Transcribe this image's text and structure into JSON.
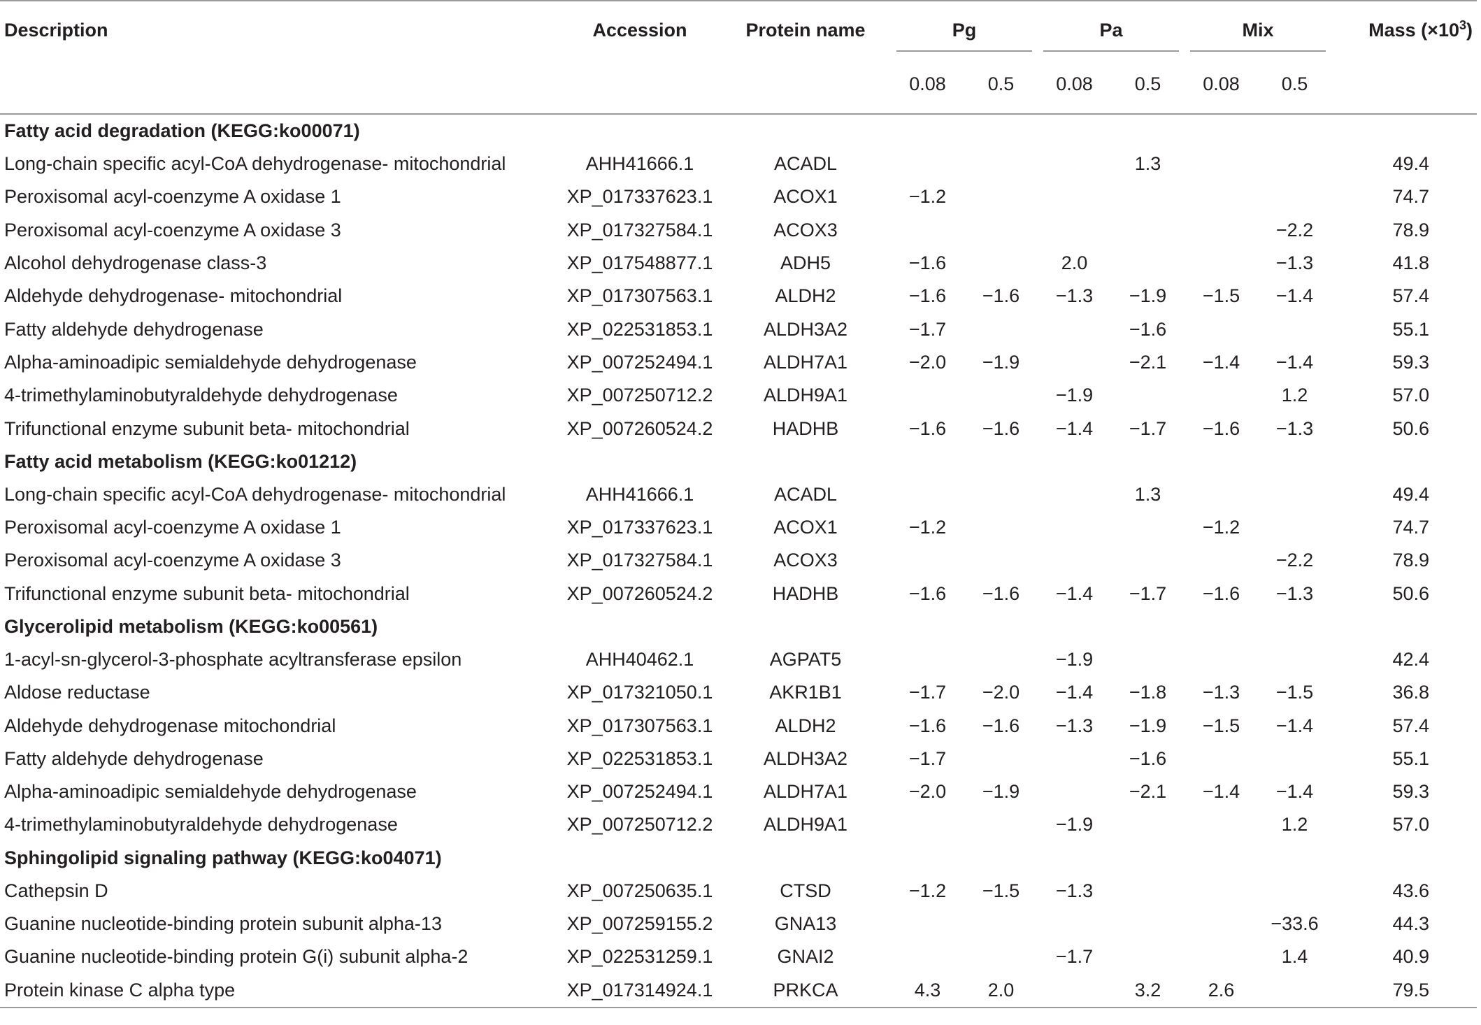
{
  "headers": {
    "description": "Description",
    "accession": "Accession",
    "protein_name": "Protein name",
    "pg": "Pg",
    "pa": "Pa",
    "mix": "Mix",
    "mass": "Mass (×10",
    "mass_exp": "3",
    "mass_close": ")",
    "sub": [
      "0.08",
      "0.5",
      "0.08",
      "0.5",
      "0.08",
      "0.5"
    ]
  },
  "sections": [
    {
      "title": "Fatty acid degradation (KEGG:ko00071)",
      "rows": [
        {
          "description": "Long-chain specific acyl-CoA dehydrogenase- mitochondrial",
          "accession": "AHH41666.1",
          "protein": "ACADL",
          "values": [
            "",
            "",
            "",
            "1.3",
            "",
            ""
          ],
          "mass": "49.4"
        },
        {
          "description": "Peroxisomal acyl-coenzyme A oxidase 1",
          "accession": "XP_017337623.1",
          "protein": "ACOX1",
          "values": [
            "−1.2",
            "",
            "",
            "",
            "",
            ""
          ],
          "mass": "74.7"
        },
        {
          "description": "Peroxisomal acyl-coenzyme A oxidase 3",
          "accession": "XP_017327584.1",
          "protein": "ACOX3",
          "values": [
            "",
            "",
            "",
            "",
            "",
            "−2.2"
          ],
          "mass": "78.9"
        },
        {
          "description": "Alcohol dehydrogenase class-3",
          "accession": "XP_017548877.1",
          "protein": "ADH5",
          "values": [
            "−1.6",
            "",
            "2.0",
            "",
            "",
            "−1.3"
          ],
          "mass": "41.8"
        },
        {
          "description": "Aldehyde dehydrogenase- mitochondrial",
          "accession": "XP_017307563.1",
          "protein": "ALDH2",
          "values": [
            "−1.6",
            "−1.6",
            "−1.3",
            "−1.9",
            "−1.5",
            "−1.4"
          ],
          "mass": "57.4"
        },
        {
          "description": "Fatty aldehyde dehydrogenase",
          "accession": "XP_022531853.1",
          "protein": "ALDH3A2",
          "values": [
            "−1.7",
            "",
            "",
            "−1.6",
            "",
            ""
          ],
          "mass": "55.1"
        },
        {
          "description": "Alpha-aminoadipic semialdehyde dehydrogenase",
          "accession": "XP_007252494.1",
          "protein": "ALDH7A1",
          "values": [
            "−2.0",
            "−1.9",
            "",
            "−2.1",
            "−1.4",
            "−1.4"
          ],
          "mass": "59.3"
        },
        {
          "description": "4-trimethylaminobutyraldehyde dehydrogenase",
          "accession": "XP_007250712.2",
          "protein": "ALDH9A1",
          "values": [
            "",
            "",
            "−1.9",
            "",
            "",
            "1.2"
          ],
          "mass": "57.0"
        },
        {
          "description": "Trifunctional enzyme subunit beta- mitochondrial",
          "accession": "XP_007260524.2",
          "protein": "HADHB",
          "values": [
            "−1.6",
            "−1.6",
            "−1.4",
            "−1.7",
            "−1.6",
            "−1.3"
          ],
          "mass": "50.6"
        }
      ]
    },
    {
      "title": "Fatty acid metabolism (KEGG:ko01212)",
      "rows": [
        {
          "description": "Long-chain specific acyl-CoA dehydrogenase- mitochondrial",
          "accession": "AHH41666.1",
          "protein": "ACADL",
          "values": [
            "",
            "",
            "",
            "1.3",
            "",
            ""
          ],
          "mass": "49.4"
        },
        {
          "description": "Peroxisomal acyl-coenzyme A oxidase 1",
          "accession": "XP_017337623.1",
          "protein": "ACOX1",
          "values": [
            "−1.2",
            "",
            "",
            "",
            "−1.2",
            ""
          ],
          "mass": "74.7"
        },
        {
          "description": "Peroxisomal acyl-coenzyme A oxidase 3",
          "accession": "XP_017327584.1",
          "protein": "ACOX3",
          "values": [
            "",
            "",
            "",
            "",
            "",
            "−2.2"
          ],
          "mass": "78.9"
        },
        {
          "description": "Trifunctional enzyme subunit beta- mitochondrial",
          "accession": "XP_007260524.2",
          "protein": "HADHB",
          "values": [
            "−1.6",
            "−1.6",
            "−1.4",
            "−1.7",
            "−1.6",
            "−1.3"
          ],
          "mass": "50.6"
        }
      ]
    },
    {
      "title": "Glycerolipid metabolism (KEGG:ko00561)",
      "rows": [
        {
          "description": "1-acyl-sn-glycerol-3-phosphate acyltransferase epsilon",
          "accession": "AHH40462.1",
          "protein": "AGPAT5",
          "values": [
            "",
            "",
            "−1.9",
            "",
            "",
            ""
          ],
          "mass": "42.4"
        },
        {
          "description": "Aldose reductase",
          "accession": "XP_017321050.1",
          "protein": "AKR1B1",
          "values": [
            "−1.7",
            "−2.0",
            "−1.4",
            "−1.8",
            "−1.3",
            "−1.5"
          ],
          "mass": "36.8"
        },
        {
          "description": "Aldehyde dehydrogenase mitochondrial",
          "accession": "XP_017307563.1",
          "protein": "ALDH2",
          "values": [
            "−1.6",
            "−1.6",
            "−1.3",
            "−1.9",
            "−1.5",
            "−1.4"
          ],
          "mass": "57.4"
        },
        {
          "description": "Fatty aldehyde dehydrogenase",
          "accession": "XP_022531853.1",
          "protein": "ALDH3A2",
          "values": [
            "−1.7",
            "",
            "",
            "−1.6",
            "",
            ""
          ],
          "mass": "55.1"
        },
        {
          "description": "Alpha-aminoadipic semialdehyde dehydrogenase",
          "accession": "XP_007252494.1",
          "protein": "ALDH7A1",
          "values": [
            "−2.0",
            "−1.9",
            "",
            "−2.1",
            "−1.4",
            "−1.4"
          ],
          "mass": "59.3"
        },
        {
          "description": "4-trimethylaminobutyraldehyde dehydrogenase",
          "accession": "XP_007250712.2",
          "protein": "ALDH9A1",
          "values": [
            "",
            "",
            "−1.9",
            "",
            "",
            "1.2"
          ],
          "mass": "57.0"
        }
      ]
    },
    {
      "title": "Sphingolipid signaling pathway (KEGG:ko04071)",
      "rows": [
        {
          "description": "Cathepsin D",
          "accession": "XP_007250635.1",
          "protein": "CTSD",
          "values": [
            "−1.2",
            "−1.5",
            "−1.3",
            "",
            "",
            ""
          ],
          "mass": "43.6"
        },
        {
          "description": "Guanine nucleotide-binding protein subunit alpha-13",
          "accession": "XP_007259155.2",
          "protein": "GNA13",
          "values": [
            "",
            "",
            "",
            "",
            "",
            "−33.6"
          ],
          "mass": "44.3"
        },
        {
          "description": "Guanine nucleotide-binding protein G(i) subunit alpha-2",
          "accession": "XP_022531259.1",
          "protein": "GNAI2",
          "values": [
            "",
            "",
            "−1.7",
            "",
            "",
            "1.4"
          ],
          "mass": "40.9"
        },
        {
          "description": "Protein kinase C alpha type",
          "accession": "XP_017314924.1",
          "protein": "PRKCA",
          "values": [
            "4.3",
            "2.0",
            "",
            "3.2",
            "2.6",
            ""
          ],
          "mass": "79.5"
        }
      ]
    }
  ]
}
